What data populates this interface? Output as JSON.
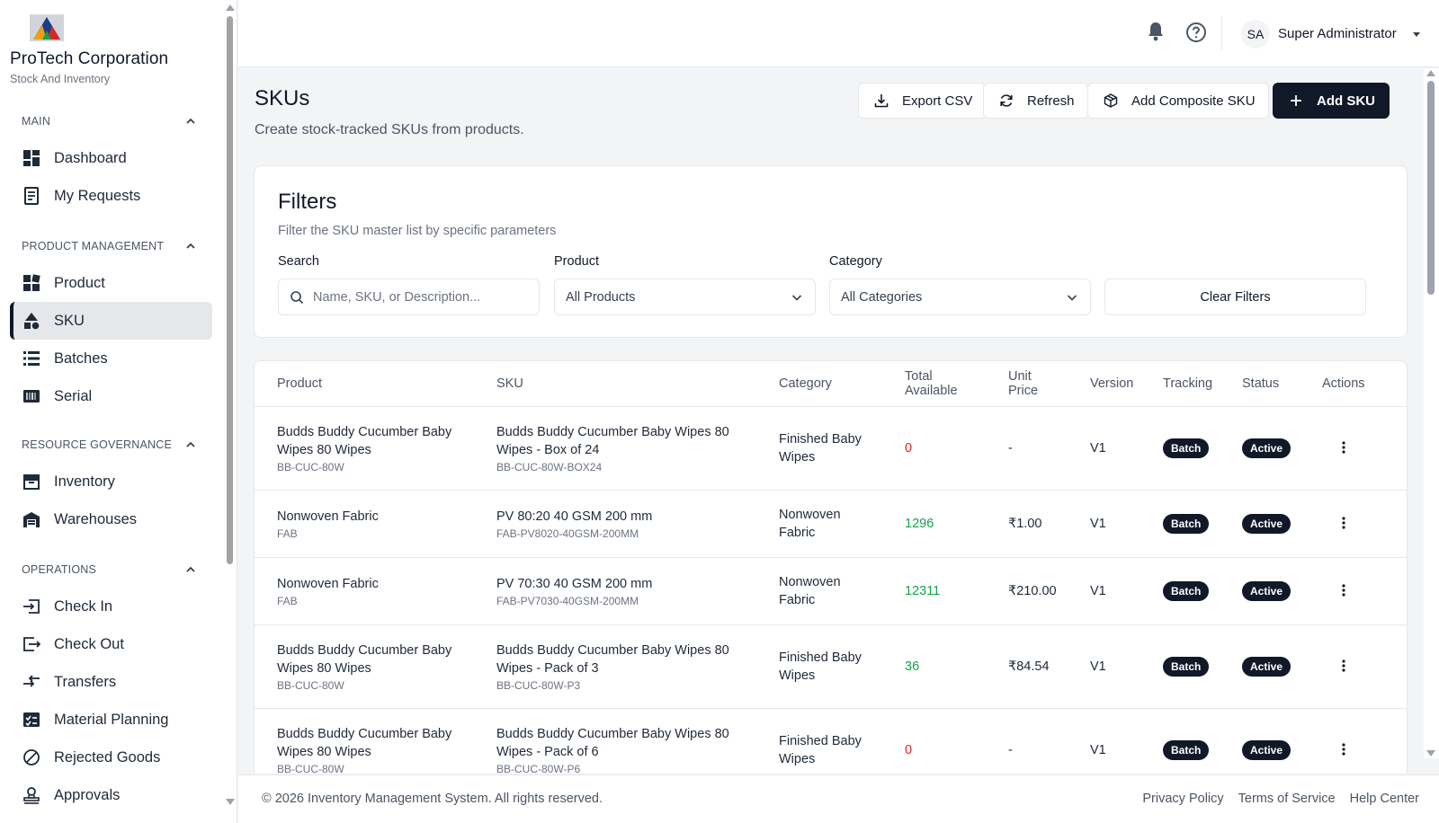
{
  "brand": {
    "name": "ProTech Corporation",
    "subtitle": "Stock And Inventory"
  },
  "sidebar": {
    "sections": [
      {
        "title": "MAIN",
        "items": [
          {
            "label": "Dashboard",
            "icon": "dashboard-icon"
          },
          {
            "label": "My Requests",
            "icon": "requests-icon"
          }
        ]
      },
      {
        "title": "PRODUCT MANAGEMENT",
        "items": [
          {
            "label": "Product",
            "icon": "product-icon"
          },
          {
            "label": "SKU",
            "icon": "sku-icon",
            "active": true
          },
          {
            "label": "Batches",
            "icon": "batches-icon"
          },
          {
            "label": "Serial",
            "icon": "serial-icon"
          }
        ]
      },
      {
        "title": "RESOURCE GOVERNANCE",
        "items": [
          {
            "label": "Inventory",
            "icon": "inventory-icon"
          },
          {
            "label": "Warehouses",
            "icon": "warehouse-icon"
          }
        ]
      },
      {
        "title": "OPERATIONS",
        "items": [
          {
            "label": "Check In",
            "icon": "check-in-icon"
          },
          {
            "label": "Check Out",
            "icon": "check-out-icon"
          },
          {
            "label": "Transfers",
            "icon": "transfers-icon"
          },
          {
            "label": "Material Planning",
            "icon": "material-planning-icon"
          },
          {
            "label": "Rejected Goods",
            "icon": "rejected-icon"
          },
          {
            "label": "Approvals",
            "icon": "approvals-icon"
          }
        ]
      }
    ]
  },
  "header": {
    "avatar_initials": "SA",
    "user_name": "Super Administrator"
  },
  "page": {
    "title": "SKUs",
    "subtitle": "Create stock-tracked SKUs from products.",
    "buttons": {
      "export": "Export CSV",
      "refresh": "Refresh",
      "add_composite": "Add Composite SKU",
      "add_sku": "Add SKU"
    }
  },
  "filters": {
    "title": "Filters",
    "subtitle": "Filter the SKU master list by specific parameters",
    "search_label": "Search",
    "search_placeholder": "Name, SKU, or Description...",
    "product_label": "Product",
    "product_value": "All Products",
    "category_label": "Category",
    "category_value": "All Categories",
    "clear": "Clear Filters"
  },
  "table": {
    "columns": [
      "Product",
      "SKU",
      "Category",
      "Total Available",
      "Unit Price",
      "Version",
      "Tracking",
      "Status",
      "Actions"
    ],
    "rows": [
      {
        "product": "Budds Buddy Cucumber Baby Wipes 80 Wipes",
        "product_code": "BB-CUC-80W",
        "sku": "Budds Buddy Cucumber Baby Wipes 80 Wipes - Box of 24",
        "sku_code": "BB-CUC-80W-BOX24",
        "category": "Finished Baby Wipes",
        "available": "0",
        "price": "-",
        "version": "V1",
        "tracking": "Batch",
        "status": "Active"
      },
      {
        "product": "Nonwoven Fabric",
        "product_code": "FAB",
        "sku": "PV 80:20 40 GSM 200 mm",
        "sku_code": "FAB-PV8020-40GSM-200MM",
        "category": "Nonwoven Fabric",
        "available": "1296",
        "price": "₹1.00",
        "version": "V1",
        "tracking": "Batch",
        "status": "Active"
      },
      {
        "product": "Nonwoven Fabric",
        "product_code": "FAB",
        "sku": "PV 70:30 40 GSM 200 mm",
        "sku_code": "FAB-PV7030-40GSM-200MM",
        "category": "Nonwoven Fabric",
        "available": "12311",
        "price": "₹210.00",
        "version": "V1",
        "tracking": "Batch",
        "status": "Active"
      },
      {
        "product": "Budds Buddy Cucumber Baby Wipes 80 Wipes",
        "product_code": "BB-CUC-80W",
        "sku": "Budds Buddy Cucumber Baby Wipes 80 Wipes - Pack of 3",
        "sku_code": "BB-CUC-80W-P3",
        "category": "Finished Baby Wipes",
        "available": "36",
        "price": "₹84.54",
        "version": "V1",
        "tracking": "Batch",
        "status": "Active"
      },
      {
        "product": "Budds Buddy Cucumber Baby Wipes 80 Wipes",
        "product_code": "BB-CUC-80W",
        "sku": "Budds Buddy Cucumber Baby Wipes 80 Wipes - Pack of 6",
        "sku_code": "BB-CUC-80W-P6",
        "category": "Finished Baby Wipes",
        "available": "0",
        "price": "-",
        "version": "V1",
        "tracking": "Batch",
        "status": "Active"
      }
    ]
  },
  "footer": {
    "copyright": "© 2026 Inventory Management System. All rights reserved.",
    "links": [
      "Privacy Policy",
      "Terms of Service",
      "Help Center"
    ]
  },
  "colors": {
    "primary": "#111827",
    "positive": "#16a34a",
    "negative": "#dc2626",
    "active_nav_bg": "#e5e7eb"
  }
}
